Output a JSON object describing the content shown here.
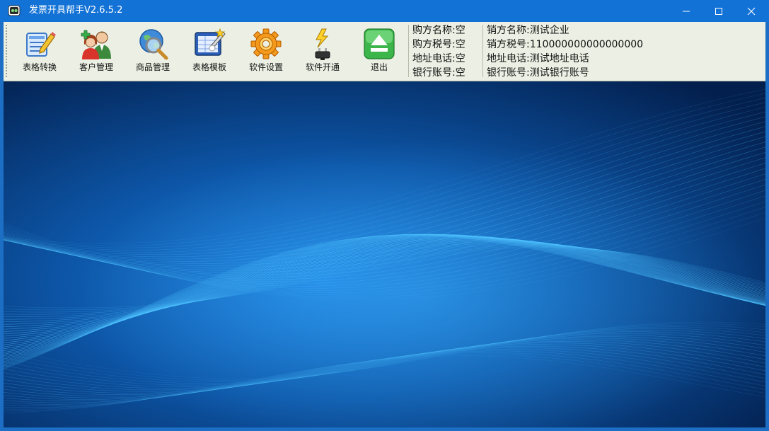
{
  "window": {
    "title": "发票开具帮手V2.6.5.2",
    "controls": [
      "minimize-icon",
      "maximize-icon",
      "close-icon"
    ]
  },
  "toolbar": {
    "buttons": [
      {
        "label": "表格转换",
        "icon": "table-convert-icon"
      },
      {
        "label": "客户管理",
        "icon": "customer-management-icon"
      },
      {
        "label": "商品管理",
        "icon": "product-search-icon"
      },
      {
        "label": "表格模板",
        "icon": "table-template-icon"
      },
      {
        "label": "软件设置",
        "icon": "gear-settings-icon"
      },
      {
        "label": "软件开通",
        "icon": "power-plug-icon"
      },
      {
        "label": "退出",
        "icon": "exit-eject-icon"
      }
    ]
  },
  "buyer": {
    "rows": [
      {
        "label": "购方名称:",
        "value": "空"
      },
      {
        "label": "购方税号:",
        "value": "空"
      },
      {
        "label": "地址电话:",
        "value": "空"
      },
      {
        "label": "银行账号:",
        "value": "空"
      }
    ]
  },
  "seller": {
    "rows": [
      {
        "label": "销方名称:",
        "value": "测试企业"
      },
      {
        "label": "销方税号:",
        "value": "110000000000000000"
      },
      {
        "label": "地址电话:",
        "value": "测试地址电话"
      },
      {
        "label": "银行账号:",
        "value": "测试银行账号"
      }
    ]
  },
  "colors": {
    "titlebar": "#1272d6",
    "toolbar": "#ecf0e4",
    "background_dark": "#031f4d",
    "background_light": "#1e82df",
    "wave": "#4fc3ff"
  }
}
